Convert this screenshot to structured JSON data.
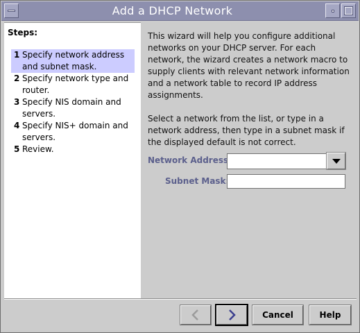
{
  "window": {
    "title": "Add a DHCP Network"
  },
  "steps": {
    "heading": "Steps:",
    "items": [
      {
        "num": "1",
        "label": "Specify network address and subnet mask.",
        "active": true
      },
      {
        "num": "2",
        "label": "Specify network type and router.",
        "active": false
      },
      {
        "num": "3",
        "label": "Specify NIS domain and servers.",
        "active": false
      },
      {
        "num": "4",
        "label": "Specify NIS+ domain and servers.",
        "active": false
      },
      {
        "num": "5",
        "label": "Review.",
        "active": false
      }
    ]
  },
  "content": {
    "intro": "This wizard will help you configure additional networks on your DHCP server.  For each network, the wizard creates a network macro to supply clients with relevant network information and a network table to record IP address assignments.",
    "instructions": "Select a network from the list, or type in a network address, then type in a subnet mask if the displayed default is not correct."
  },
  "form": {
    "network_address_label": "Network Address:",
    "network_address_value": "",
    "subnet_mask_label": "Subnet Mask:",
    "subnet_mask_value": ""
  },
  "buttons": {
    "back_icon": "chevron-left-icon",
    "next_icon": "chevron-right-icon",
    "cancel_label": "Cancel",
    "help_label": "Help"
  },
  "colors": {
    "titlebar": "#8d8fae",
    "active_step": "#ccccff",
    "field_label": "#5b5f8c"
  }
}
